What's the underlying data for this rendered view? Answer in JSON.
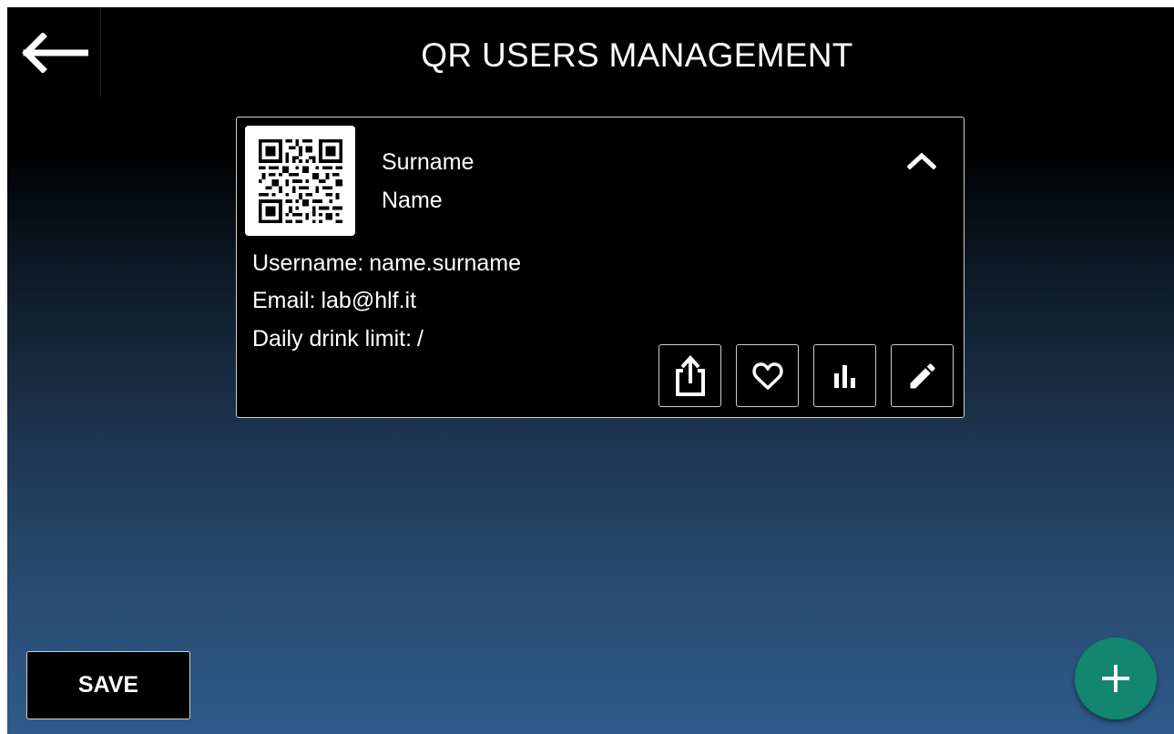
{
  "header": {
    "title": "QR USERS MANAGEMENT",
    "back_icon": "arrow-left-icon"
  },
  "user_card": {
    "surname": "Surname",
    "name": "Name",
    "username_label": "Username:",
    "username": "name.surname",
    "email_label": "Email:",
    "email": "lab@hlf.it",
    "daily_limit_label": "Daily drink limit:",
    "daily_limit": "/",
    "expanded": true,
    "icons": {
      "qr": "qr-code-icon",
      "collapse": "chevron-up-icon",
      "share": "share-icon",
      "favorite": "heart-icon",
      "stats": "bar-chart-icon",
      "edit": "pencil-icon"
    }
  },
  "footer": {
    "save_label": "SAVE",
    "add_icon": "plus-icon"
  },
  "colors": {
    "background_top": "#000000",
    "background_bottom": "#2e5b8c",
    "fab": "#12866f",
    "border": "#d0d0d0"
  }
}
